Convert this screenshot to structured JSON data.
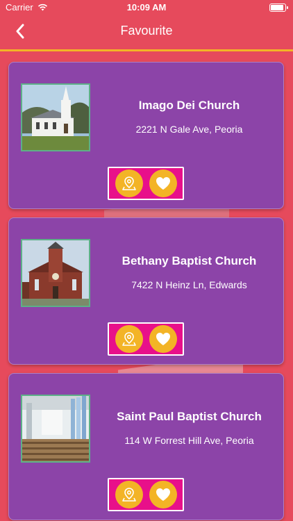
{
  "status_bar": {
    "carrier": "Carrier",
    "time": "10:09 AM"
  },
  "nav": {
    "title": "Favourite"
  },
  "colors": {
    "background": "#e64a5c",
    "card": "#8c44a8",
    "accent": "#f3b426",
    "action_bar": "#e8108a"
  },
  "churches": [
    {
      "name": "Imago Dei Church",
      "address": "2221 N Gale Ave, Peoria",
      "image_icon": "church-photo"
    },
    {
      "name": "Bethany Baptist Church",
      "address": "7422 N Heinz Ln, Edwards",
      "image_icon": "church-photo"
    },
    {
      "name": "Saint Paul Baptist Church",
      "address": "114 W Forrest Hill Ave, Peoria",
      "image_icon": "church-interior-photo"
    }
  ],
  "icons": {
    "map": "map-pin-icon",
    "favourite": "heart-icon",
    "back": "chevron-left-icon",
    "wifi": "wifi-icon",
    "battery": "battery-icon"
  }
}
